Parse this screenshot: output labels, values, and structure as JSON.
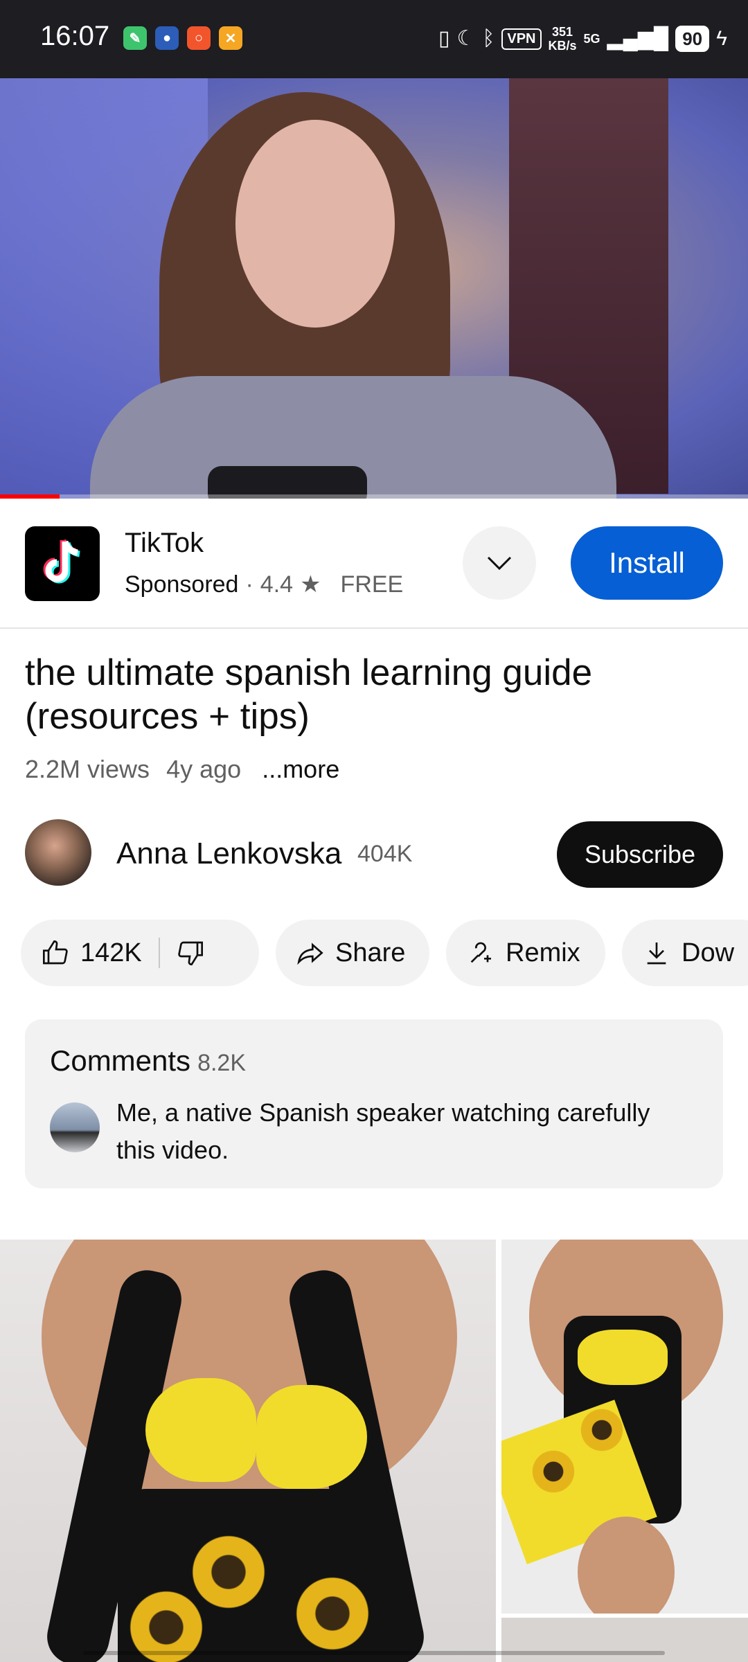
{
  "status_bar": {
    "time": "16:07",
    "vpn": "VPN",
    "speed_value": "351",
    "speed_unit": "KB/s",
    "network": "5G",
    "battery": "90"
  },
  "video": {
    "progress_fraction": 0.08
  },
  "ad": {
    "app_name": "TikTok",
    "sponsored": "Sponsored",
    "separator": "·",
    "rating": "4.4",
    "price": "FREE",
    "install_label": "Install"
  },
  "video_info": {
    "title": "the ultimate spanish learning guide (resources + tips)",
    "views": "2.2M views",
    "age": "4y ago",
    "more": "...more"
  },
  "channel": {
    "name": "Anna Lenkovska",
    "subscribers": "404K",
    "subscribe_label": "Subscribe"
  },
  "actions": {
    "likes": "142K",
    "share": "Share",
    "remix": "Remix",
    "download": "Dow"
  },
  "comments": {
    "heading": "Comments",
    "count": "8.2K",
    "top_comment": "Me, a native Spanish speaker watching carefully this video."
  },
  "colors": {
    "install_blue": "#065fd4",
    "progress_red": "#ff0000",
    "subscribe_black": "#0f0f0f"
  }
}
